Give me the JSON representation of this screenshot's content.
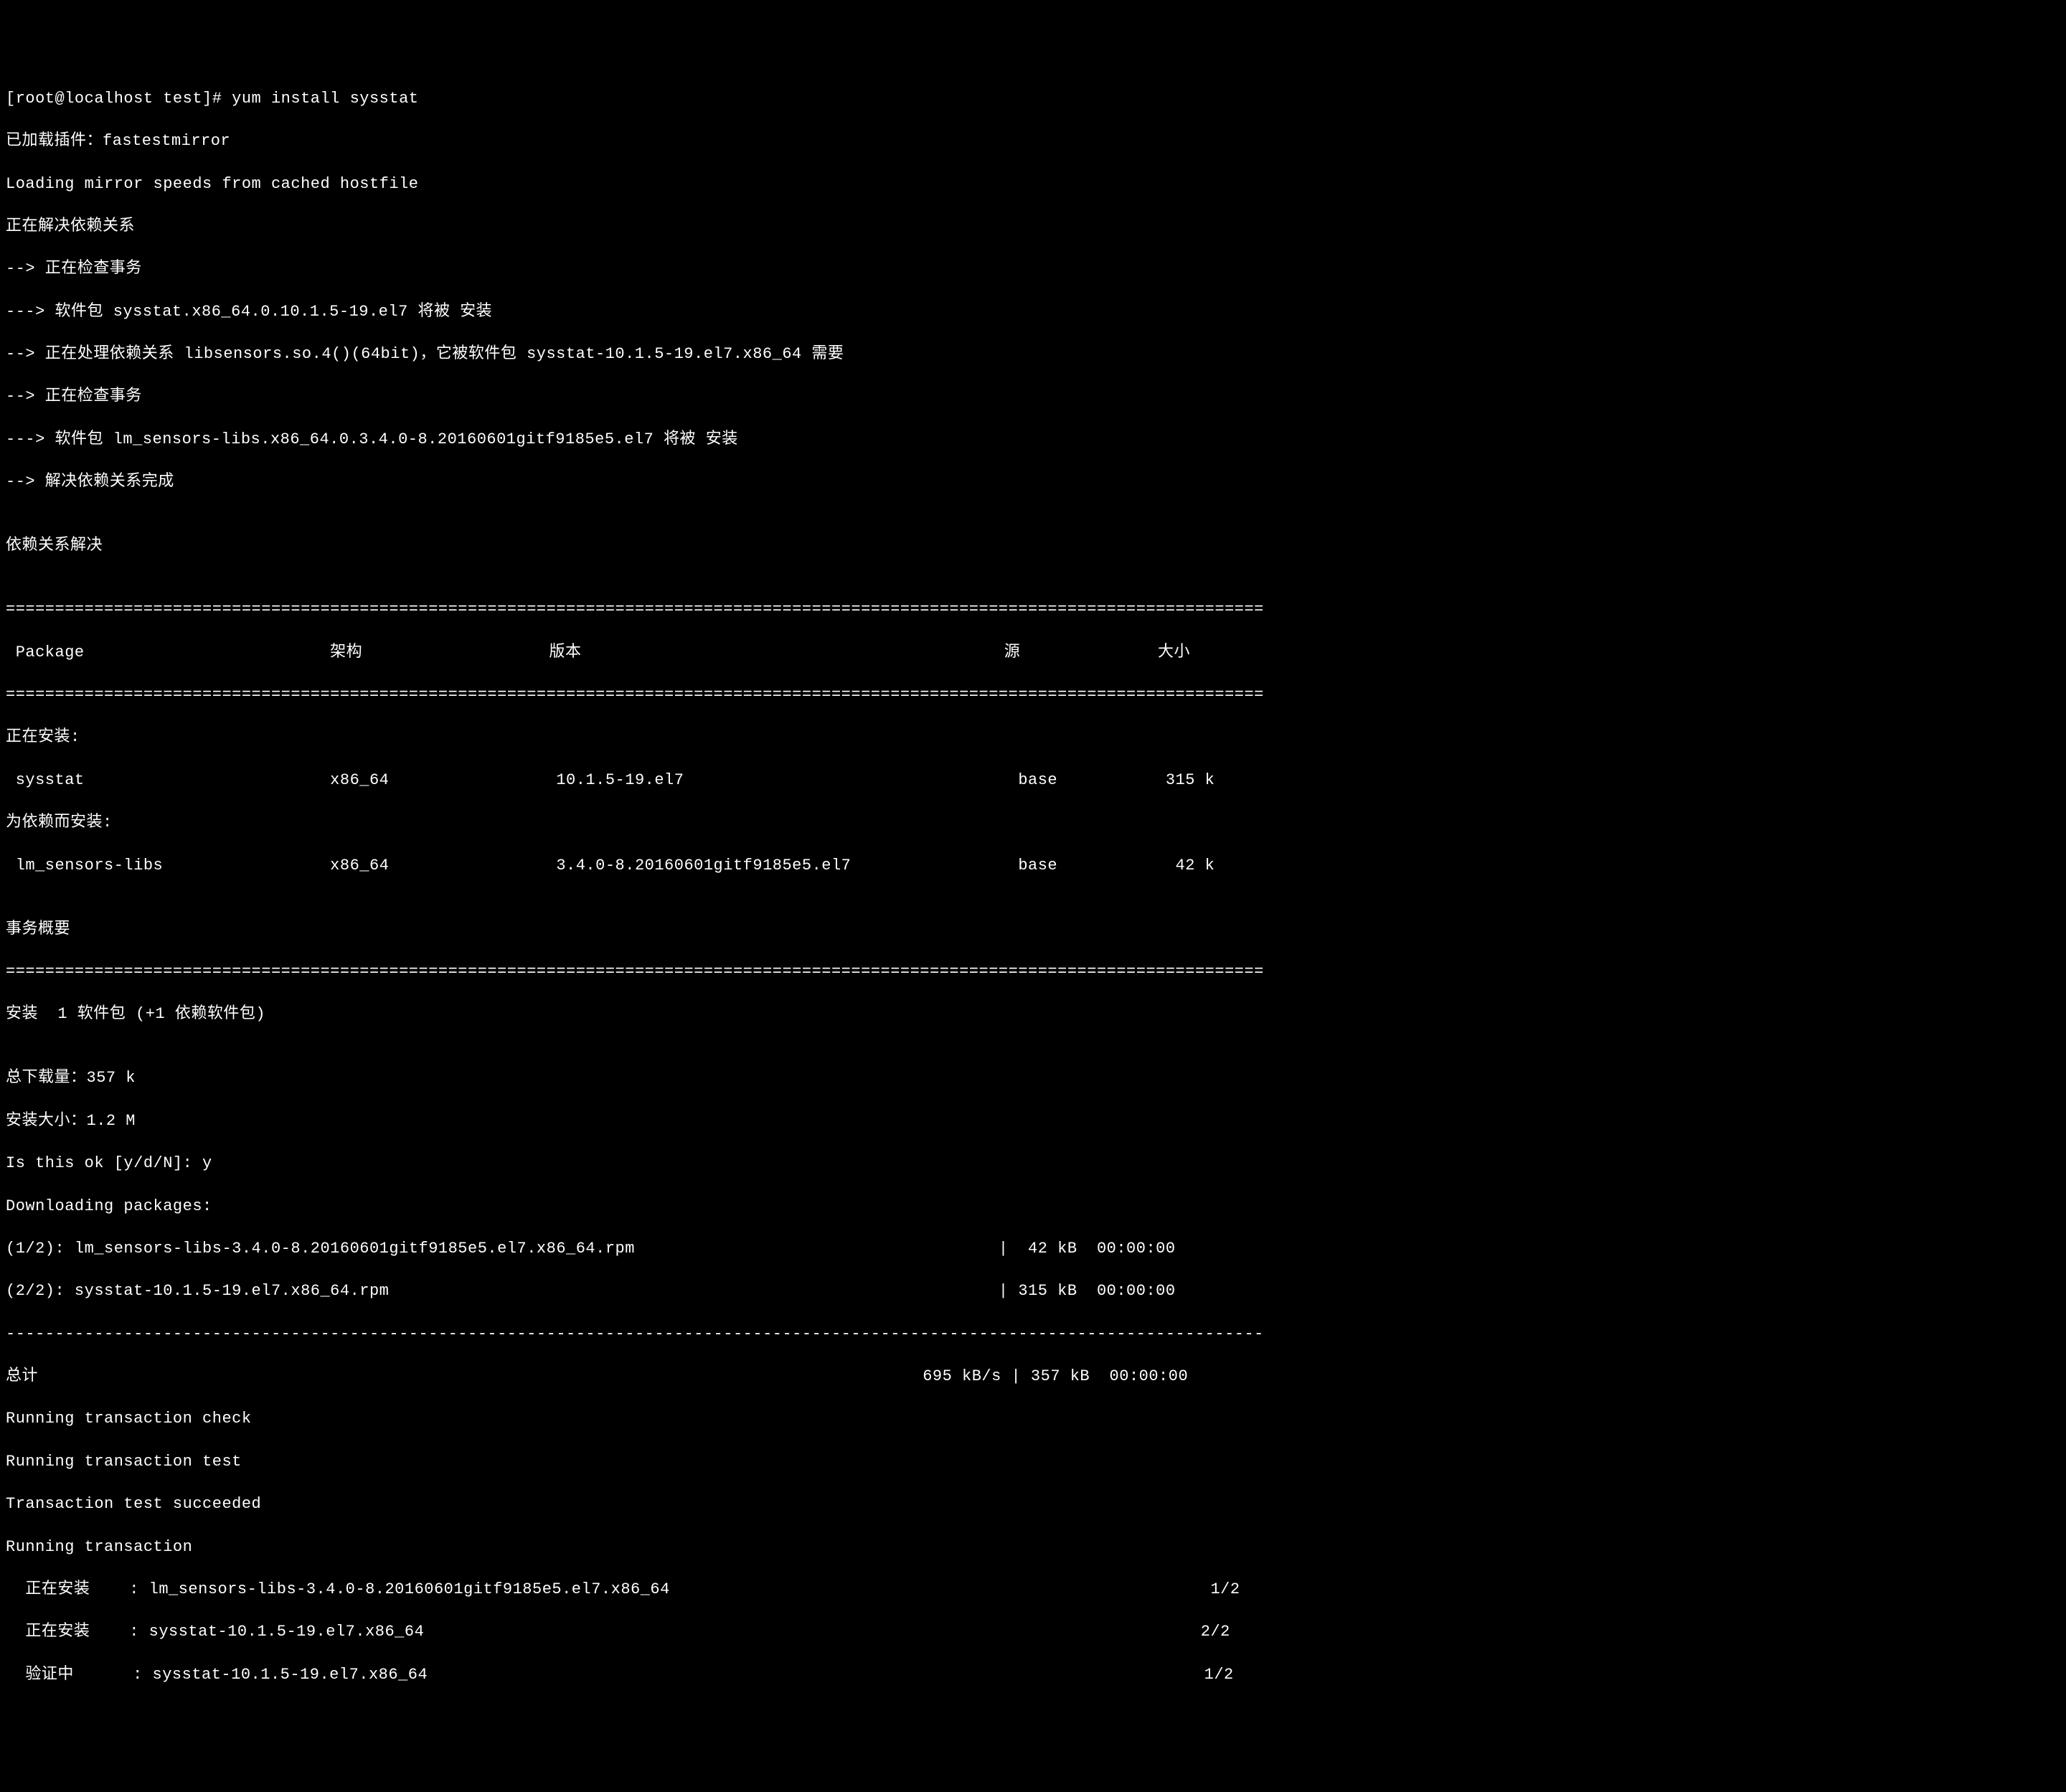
{
  "prompt": "[root@localhost test]# yum install sysstat",
  "lines": {
    "l1": "已加载插件：fastestmirror",
    "l2": "Loading mirror speeds from cached hostfile",
    "l3": "正在解决依赖关系",
    "l4": "--> 正在检查事务",
    "l5": "---> 软件包 sysstat.x86_64.0.10.1.5-19.el7 将被 安装",
    "l6": "--> 正在处理依赖关系 libsensors.so.4()(64bit)，它被软件包 sysstat-10.1.5-19.el7.x86_64 需要",
    "l7": "--> 正在检查事务",
    "l8": "---> 软件包 lm_sensors-libs.x86_64.0.3.4.0-8.20160601gitf9185e5.el7 将被 安装",
    "l9": "--> 解决依赖关系完成",
    "l10": "",
    "l11": "依赖关系解决",
    "l12": "",
    "sep1": "================================================================================================================================",
    "header": " Package                         架构                   版本                                           源              大小",
    "sep2": "================================================================================================================================",
    "l13": "正在安装:",
    "pkg1": " sysstat                         x86_64                 10.1.5-19.el7                                  base           315 k",
    "l14": "为依赖而安装:",
    "pkg2": " lm_sensors-libs                 x86_64                 3.4.0-8.20160601gitf9185e5.el7                 base            42 k",
    "l15": "",
    "l16": "事务概要",
    "sep3": "================================================================================================================================",
    "l17": "安装  1 软件包 (+1 依赖软件包)",
    "l18": "",
    "l19": "总下载量：357 k",
    "l20": "安装大小：1.2 M",
    "l21": "Is this ok [y/d/N]: y",
    "l22": "Downloading packages:",
    "dl1": "(1/2): lm_sensors-libs-3.4.0-8.20160601gitf9185e5.el7.x86_64.rpm                                     |  42 kB  00:00:00",
    "dl2": "(2/2): sysstat-10.1.5-19.el7.x86_64.rpm                                                              | 315 kB  00:00:00",
    "sep4": "--------------------------------------------------------------------------------------------------------------------------------",
    "total": "总计                                                                                          695 kB/s | 357 kB  00:00:00",
    "l23": "Running transaction check",
    "l24": "Running transaction test",
    "l25": "Transaction test succeeded",
    "l26": "Running transaction",
    "inst1": "  正在安装    : lm_sensors-libs-3.4.0-8.20160601gitf9185e5.el7.x86_64                                                       1/2",
    "inst2": "  正在安装    : sysstat-10.1.5-19.el7.x86_64                                                                               2/2",
    "verify1": "  验证中      : sysstat-10.1.5-19.el7.x86_64                                                                               1/2"
  }
}
